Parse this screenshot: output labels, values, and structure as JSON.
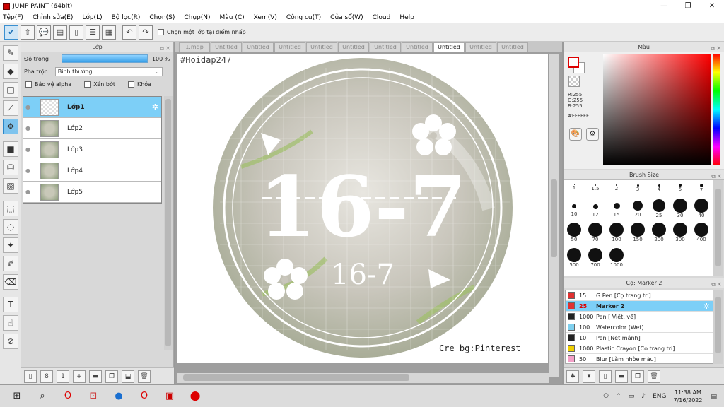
{
  "window": {
    "title": "JUMP PAINT (64bit)",
    "min": "—",
    "max": "❐",
    "close": "✕"
  },
  "menu": [
    "Tệp(F)",
    "Chỉnh sửa(E)",
    "Lớp(L)",
    "Bộ lọc(R)",
    "Chọn(S)",
    "Chụp(N)",
    "Màu (C)",
    "Xem(V)",
    "Công cụ(T)",
    "Cửa sổ(W)",
    "Cloud",
    "Help"
  ],
  "toolbar": {
    "pick_layer_label": "Chọn một lớp tại điểm nhấp"
  },
  "layer_panel": {
    "title": "Lớp",
    "opacity_label": "Độ trong",
    "opacity_value": "100 %",
    "opacity": 1.0,
    "blend_label": "Pha trộn",
    "blend_value": "Bình thường",
    "protect_alpha": "Bảo vệ alpha",
    "clipping": "Xén bớt",
    "lock": "Khóa",
    "layers": [
      {
        "name": "Lớp1",
        "selected": true
      },
      {
        "name": "Lớp2",
        "selected": false
      },
      {
        "name": "Lớp3",
        "selected": false
      },
      {
        "name": "Lớp4",
        "selected": false
      },
      {
        "name": "Lớp5",
        "selected": false
      }
    ]
  },
  "tabs": [
    {
      "label": "1.mdp",
      "active": false
    },
    {
      "label": "Untitled",
      "active": false
    },
    {
      "label": "Untitled",
      "active": false
    },
    {
      "label": "Untitled",
      "active": false
    },
    {
      "label": "Untitled",
      "active": false
    },
    {
      "label": "Untitled",
      "active": false
    },
    {
      "label": "Untitled",
      "active": false
    },
    {
      "label": "Untitled",
      "active": false
    },
    {
      "label": "Untitled",
      "active": true
    },
    {
      "label": "Untitled",
      "active": false
    },
    {
      "label": "Untitled",
      "active": false
    }
  ],
  "canvas": {
    "watermark_top": "#Hoidap247",
    "big_text": "16-7",
    "small_text": "16-7",
    "credit": "Cre bg:Pinterest"
  },
  "color_panel": {
    "title": "Màu",
    "r": "R:255",
    "g": "G:255",
    "b": "B:255",
    "hex": "#FFFFFF",
    "primary": "#ffffff",
    "accent": "#e00000"
  },
  "brush_size": {
    "title": "Brush Size",
    "sizes": [
      "1",
      "1.5",
      "2",
      "3",
      "4",
      "5",
      "7",
      "10",
      "12",
      "15",
      "20",
      "25",
      "30",
      "40",
      "50",
      "70",
      "100",
      "150",
      "200",
      "300",
      "400",
      "500",
      "700",
      "1000"
    ]
  },
  "brush_list": {
    "title": "Cọ: Marker 2",
    "items": [
      {
        "size": "15",
        "name": "G Pen [Cọ trang trí]",
        "color": "#e03030",
        "selected": false
      },
      {
        "size": "25",
        "name": "Marker 2",
        "color": "#e03030",
        "selected": true
      },
      {
        "size": "1000",
        "name": "Pen [ Viết, vẽ]",
        "color": "#222222",
        "selected": false
      },
      {
        "size": "100",
        "name": "Watercolor (Wet)",
        "color": "#7fd0ee",
        "selected": false
      },
      {
        "size": "10",
        "name": "Pen [Nét mảnh]",
        "color": "#222222",
        "selected": false
      },
      {
        "size": "1000",
        "name": "Plastic Crayon [Cọ trang trí]",
        "color": "#f0d000",
        "selected": false
      },
      {
        "size": "50",
        "name": "Blur [Làm nhòe màu]",
        "color": "#f4a0c8",
        "selected": false
      }
    ]
  },
  "taskbar": {
    "lang": "ENG",
    "time": "11:38 AM",
    "date": "7/16/2022"
  }
}
